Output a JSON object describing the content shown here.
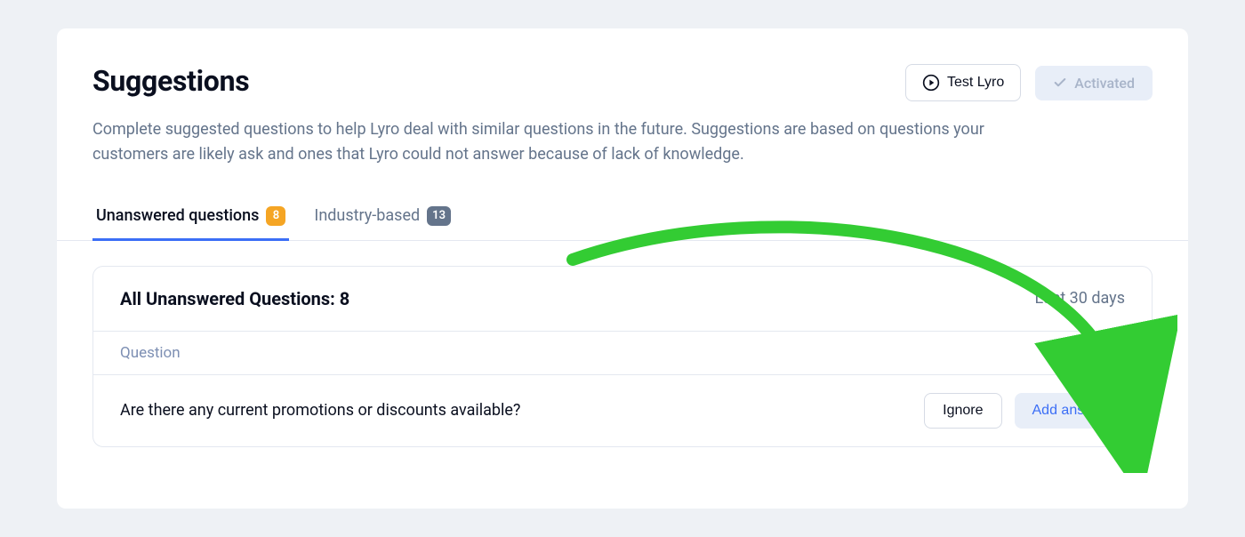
{
  "header": {
    "title": "Suggestions",
    "test_btn_label": "Test Lyro",
    "activated_label": "Activated"
  },
  "description": "Complete suggested questions to help Lyro deal with similar questions in the future. Suggestions are based on questions your customers are likely ask and ones that Lyro could not answer because of lack of knowledge.",
  "tabs": {
    "unanswered": {
      "label": "Unanswered questions",
      "count": "8"
    },
    "industry": {
      "label": "Industry-based",
      "count": "13"
    }
  },
  "panel": {
    "title": "All Unanswered Questions: 8",
    "range_label": "Last 30 days",
    "column_header": "Question",
    "rows": [
      {
        "question": "Are there any current promotions or discounts available?",
        "ignore_label": "Ignore",
        "add_answer_label": "Add answer"
      }
    ]
  }
}
